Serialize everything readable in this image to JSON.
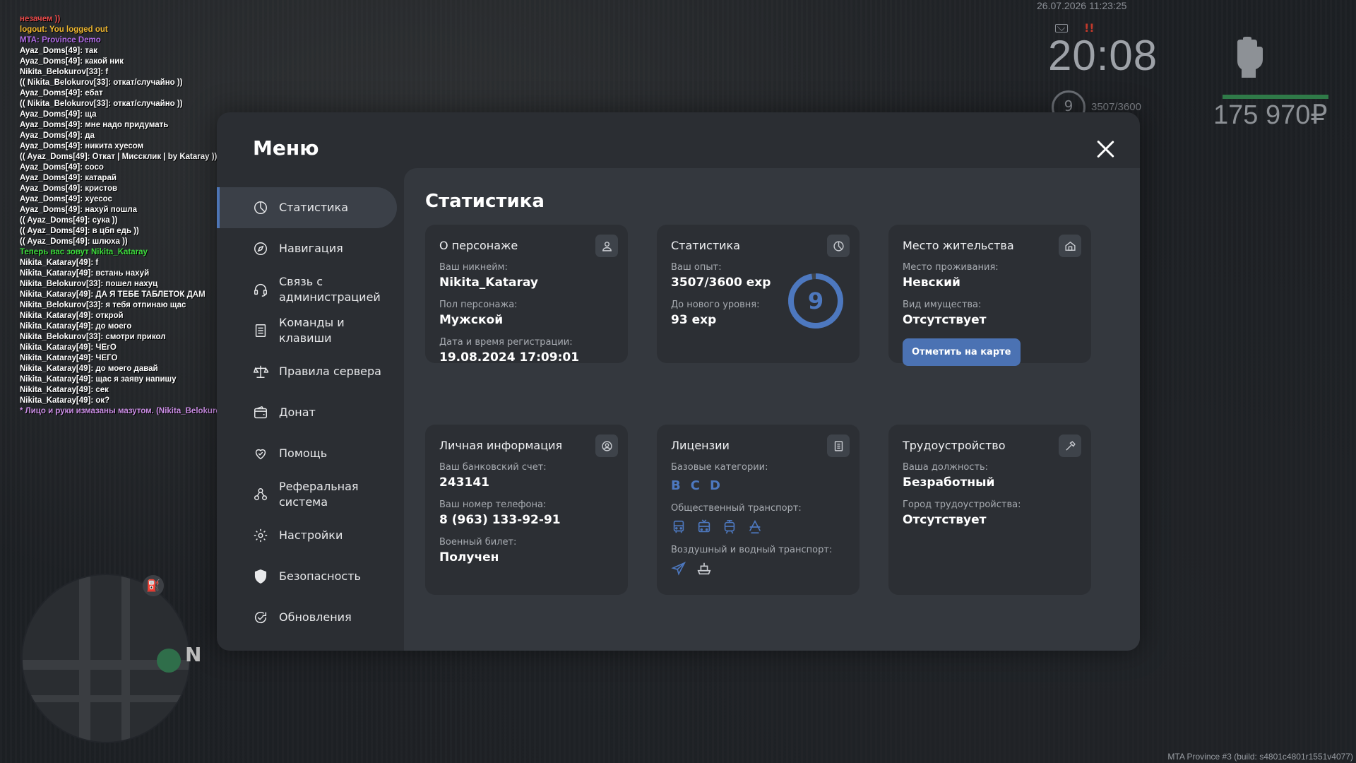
{
  "chat": [
    {
      "text": "незачем ))",
      "color": "#e84a4a"
    },
    {
      "text": "logout: You logged out",
      "color": "#f0b830"
    },
    {
      "text": "MTA: Province Demo",
      "color": "#b06ce6"
    },
    {
      "text": "Ayaz_Doms[49]: так",
      "color": "#ffffff"
    },
    {
      "text": "Ayaz_Doms[49]: какой ник",
      "color": "#ffffff"
    },
    {
      "text": "Nikita_Belokurov[33]: f",
      "color": "#ffffff"
    },
    {
      "text": "(( Nikita_Belokurov[33]: откат/случайно ))",
      "color": "#ffffff"
    },
    {
      "text": "Ayaz_Doms[49]: ебат",
      "color": "#ffffff"
    },
    {
      "text": "(( Nikita_Belokurov[33]: откат/случайно ))",
      "color": "#ffffff"
    },
    {
      "text": "Ayaz_Doms[49]: ща",
      "color": "#ffffff"
    },
    {
      "text": "Ayaz_Doms[49]: мне надо придумать",
      "color": "#ffffff"
    },
    {
      "text": "Ayaz_Doms[49]: да",
      "color": "#ffffff"
    },
    {
      "text": "Ayaz_Doms[49]: никита хуесом",
      "color": "#ffffff"
    },
    {
      "text": "(( Ayaz_Doms[49]: Откат | Миссклик | by Kataray ))",
      "color": "#ffffff"
    },
    {
      "text": "Ayaz_Doms[49]: сосо",
      "color": "#ffffff"
    },
    {
      "text": "Ayaz_Doms[49]: катарай",
      "color": "#ffffff"
    },
    {
      "text": "Ayaz_Doms[49]: кристов",
      "color": "#ffffff"
    },
    {
      "text": "Ayaz_Doms[49]: хуесос",
      "color": "#ffffff"
    },
    {
      "text": "Ayaz_Doms[49]: нахуй пошла",
      "color": "#ffffff"
    },
    {
      "text": "(( Ayaz_Doms[49]: сука ))",
      "color": "#ffffff"
    },
    {
      "text": "(( Ayaz_Doms[49]: в цбп едь ))",
      "color": "#ffffff"
    },
    {
      "text": "(( Ayaz_Doms[49]: шлюха ))",
      "color": "#ffffff"
    },
    {
      "text": "Теперь вас зовут Nikita_Kataray",
      "color": "#3ddc3d"
    },
    {
      "text": "Nikita_Kataray[49]: f",
      "color": "#ffffff"
    },
    {
      "text": "Nikita_Kataray[49]: встань нахуй",
      "color": "#ffffff"
    },
    {
      "text": "Nikita_Belokurov[33]: пошел нахуц",
      "color": "#ffffff"
    },
    {
      "text": "Nikita_Kataray[49]: ДА Я ТЕБЕ ТАБЛЕТОК ДАМ",
      "color": "#ffffff"
    },
    {
      "text": "Nikita_Belokurov[33]: я тебя отпинаю щас",
      "color": "#ffffff"
    },
    {
      "text": "Nikita_Kataray[49]: открой",
      "color": "#ffffff"
    },
    {
      "text": "Nikita_Kataray[49]: до моего",
      "color": "#ffffff"
    },
    {
      "text": "Nikita_Belokurov[33]: смотри прикол",
      "color": "#ffffff"
    },
    {
      "text": "Nikita_Kataray[49]: ЧЕгО",
      "color": "#ffffff"
    },
    {
      "text": "Nikita_Kataray[49]: ЧЕГО",
      "color": "#ffffff"
    },
    {
      "text": "Nikita_Kataray[49]: до моего давай",
      "color": "#ffffff"
    },
    {
      "text": "Nikita_Kataray[49]: щас я заяву напишу",
      "color": "#ffffff"
    },
    {
      "text": "Nikita_Kataray[49]: сек",
      "color": "#ffffff"
    },
    {
      "text": "Nikita_Kataray[49]: ок?",
      "color": "#ffffff"
    },
    {
      "text": "* Лицо и руки измазаны мазутом. (Nikita_Belokurov)",
      "color": "#cc8ee6"
    }
  ],
  "hud": {
    "datetime": "26.07.2026 11:23:25",
    "alert": "!!",
    "clock": "20:08",
    "level": "9",
    "exp": "3507/3600",
    "money": "175 970₽",
    "compass": "N",
    "fuel_icon": "fuel-icon",
    "fist_icon": "fist-icon"
  },
  "build_info": "MTA Province #3 (build: s4801c4801r1551v4077)",
  "menu": {
    "title": "Меню",
    "nav": [
      {
        "label": "Статистика",
        "icon": "pie-chart-icon",
        "active": true
      },
      {
        "label": "Навигация",
        "icon": "compass-icon"
      },
      {
        "label": "Связь с администрацией",
        "icon": "headset-icon"
      },
      {
        "label": "Команды и клавиши",
        "icon": "document-icon"
      },
      {
        "label": "Правила сервера",
        "icon": "scales-icon"
      },
      {
        "label": "Донат",
        "icon": "wallet-icon"
      },
      {
        "label": "Помощь",
        "icon": "heart-hand-icon"
      },
      {
        "label": "Реферальная система",
        "icon": "referral-icon"
      },
      {
        "label": "Настройки",
        "icon": "gear-icon"
      },
      {
        "label": "Безопасность",
        "icon": "shield-icon"
      },
      {
        "label": "Обновления",
        "icon": "refresh-check-icon"
      }
    ]
  },
  "stats": {
    "title": "Статистика",
    "character": {
      "title": "О персонаже",
      "icon": "user-icon",
      "nickname_label": "Ваш никнейм:",
      "nickname": "Nikita_Kataray",
      "gender_label": "Пол персонажа:",
      "gender": "Мужской",
      "reg_label": "Дата и время регистрации:",
      "reg": "19.08.2024 17:09:01"
    },
    "statistics": {
      "title": "Статистика",
      "icon": "pie-chart-icon",
      "exp_label": "Ваш опыт:",
      "exp": "3507/3600 exp",
      "next_label": "До нового уровня:",
      "next": "93 exp",
      "level": "9",
      "level_progress": 0.974,
      "ring_color": "#4d78bf",
      "ring_track": "#3e434a"
    },
    "residence": {
      "title": "Место жительства",
      "icon": "house-icon",
      "place_label": "Место проживания:",
      "place": "Невский",
      "property_label": "Вид имущества:",
      "property": "Отсутствует",
      "button": "Отметить на карте"
    },
    "personal": {
      "title": "Личная информация",
      "icon": "user-circle-icon",
      "bank_label": "Ваш банковский счет:",
      "bank": "243141",
      "phone_label": "Ваш номер телефона:",
      "phone": "8 (963) 133-92-91",
      "military_label": "Военный билет:",
      "military": "Получен"
    },
    "licenses": {
      "title": "Лицензии",
      "icon": "id-card-icon",
      "base_label": "Базовые категории:",
      "categories": [
        "B",
        "C",
        "D"
      ],
      "public_label": "Общественный транспорт:",
      "public_icons": [
        "bus-icon",
        "trolleybus-icon",
        "tram-icon",
        "metro-icon"
      ],
      "air_label": "Воздушный и водный транспорт:",
      "air_icons": [
        "plane-icon",
        "ship-icon"
      ]
    },
    "employment": {
      "title": "Трудоустройство",
      "icon": "hammer-icon",
      "position_label": "Ваша должность:",
      "position": "Безработный",
      "city_label": "Город трудоустройства:",
      "city": "Отсутствует"
    }
  },
  "colors": {
    "accent": "#4d78bf",
    "button": "#4b72b3",
    "panel": "#2b2e33",
    "content": "#34383e",
    "card": "#2c2f34"
  }
}
